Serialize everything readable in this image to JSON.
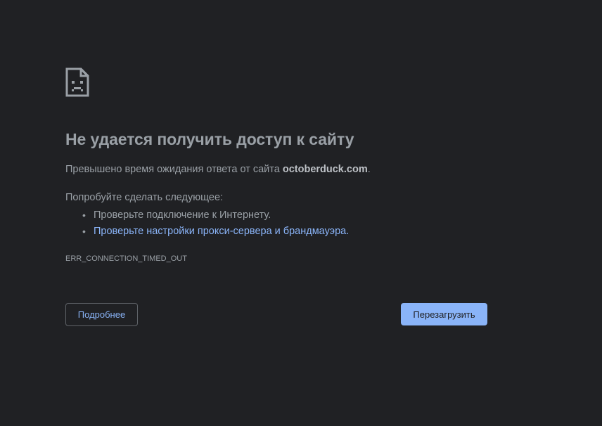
{
  "error": {
    "title": "Не удается получить доступ к сайту",
    "description_prefix": "Превышено время ожидания ответа от сайта ",
    "host": "octoberduck.com",
    "description_suffix": ".",
    "try_label": "Попробуйте сделать следующее:",
    "suggestions": [
      {
        "text": "Проверьте подключение к Интернету.",
        "is_link": false
      },
      {
        "text": "Проверьте настройки прокси-сервера и брандмауэра.",
        "is_link": true
      }
    ],
    "code": "ERR_CONNECTION_TIMED_OUT",
    "icon": "sad-page-icon"
  },
  "buttons": {
    "details_label": "Подробнее",
    "reload_label": "Перезагрузить"
  },
  "colors": {
    "background": "#202124",
    "text": "#9aa0a6",
    "link": "#8ab4f8",
    "primary_button": "#8ab4f8"
  }
}
